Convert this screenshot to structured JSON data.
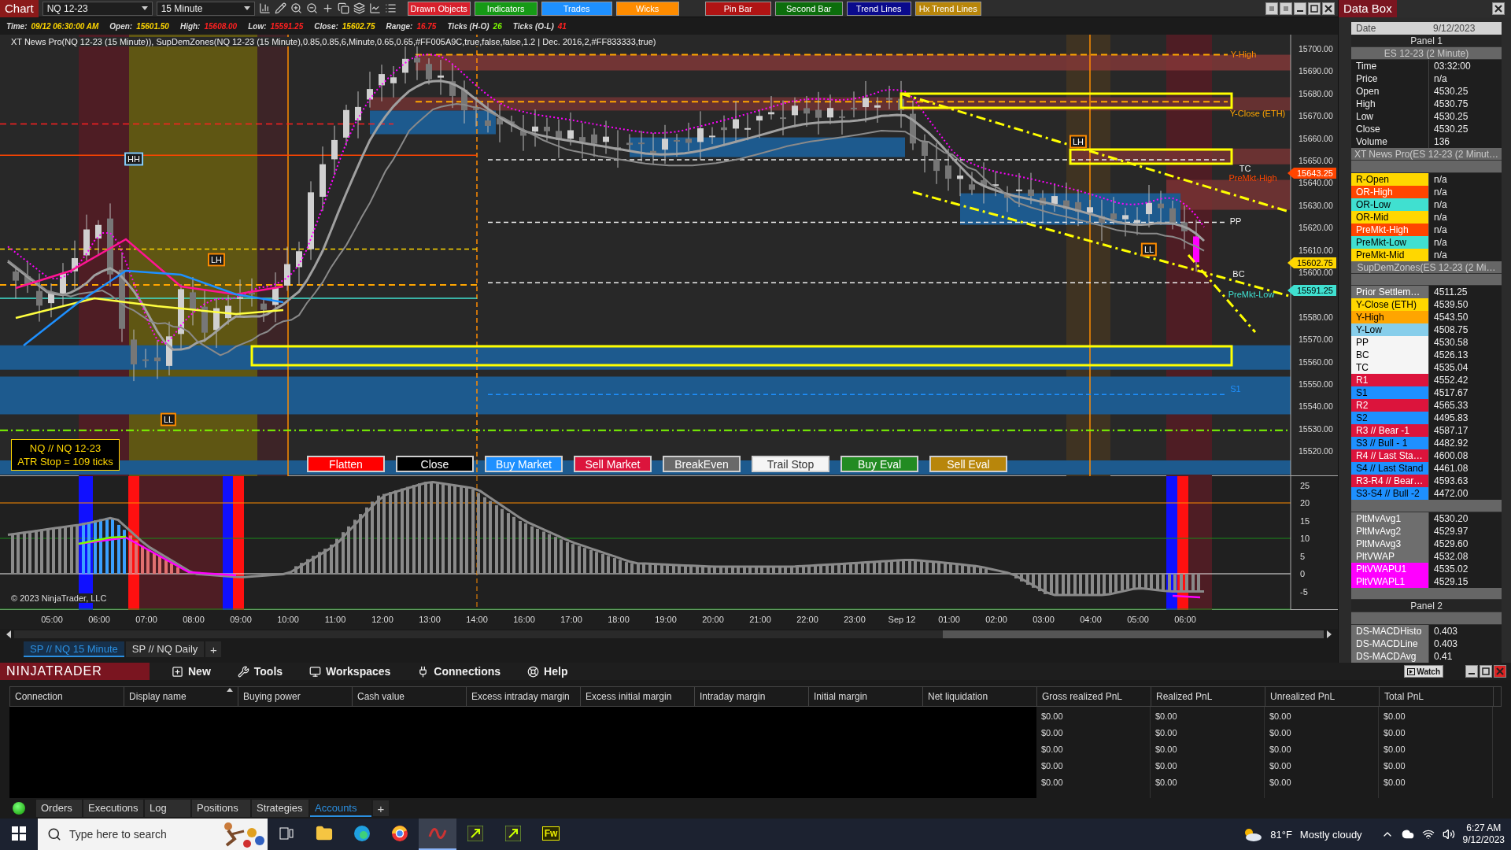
{
  "toolbar": {
    "title": "Chart",
    "instrument": "NQ 12-23",
    "interval": "15 Minute",
    "buttons": [
      {
        "label": "Drawn Objects",
        "color": "#d8202c"
      },
      {
        "label": "Indicators",
        "color": "#169a16"
      },
      {
        "label": "Trades",
        "color": "#1e90ff"
      },
      {
        "label": "Wicks",
        "color": "#ff8c00"
      },
      {
        "label": "Pin Bar",
        "color": "#b01414"
      },
      {
        "label": "Second Bar",
        "color": "#0c6e0c"
      },
      {
        "label": "Trend Lines",
        "color": "#0a0a8c"
      },
      {
        "label": "Hx Trend Lines",
        "color": "#b8860b"
      }
    ]
  },
  "stats": [
    {
      "label": "Time:",
      "value": "09/12 06:30:00 AM",
      "color": "#ffd700"
    },
    {
      "label": "Open:",
      "value": "15601.50",
      "color": "#ffd700"
    },
    {
      "label": "High:",
      "value": "15608.00",
      "color": "#ff2020"
    },
    {
      "label": "Low:",
      "value": "15591.25",
      "color": "#ff2020"
    },
    {
      "label": "Close:",
      "value": "15602.75",
      "color": "#ffd700"
    },
    {
      "label": "Range:",
      "value": "16.75",
      "color": "#ff2020"
    },
    {
      "label": "Ticks (H-O)",
      "value": "26",
      "color": "#7cfc00"
    },
    {
      "label": "Ticks (O-L)",
      "value": "41",
      "color": "#ff2020"
    }
  ],
  "indicator_line": "XT News Pro(NQ 12-23 (15 Minute)), SupDemZones(NQ 12-23 (15 Minute),0.85,0.85,6,Minute,0.65,0.65,#FF005A9C,true,false,false,1.2 | Dec. 2016,2,#FF833333,true)",
  "price_axis": [
    "15700.00",
    "15690.00",
    "15680.00",
    "15670.00",
    "15660.00",
    "15650.00",
    "15640.00",
    "15630.00",
    "15620.00",
    "15610.00",
    "15600.00",
    "15580.00",
    "15570.00",
    "15560.00",
    "15550.00",
    "15540.00",
    "15530.00",
    "15520.00"
  ],
  "price_markers": [
    {
      "text": "15643.25",
      "color": "#ff4500"
    },
    {
      "text": "15602.75",
      "color": "#ffd700"
    },
    {
      "text": "15591.25",
      "color": "#40e0d0"
    }
  ],
  "chart_labels": [
    {
      "text": "HH",
      "kind": "swing",
      "color": "#87cefa"
    },
    {
      "text": "LH",
      "kind": "swing",
      "color": "#ff8c00"
    },
    {
      "text": "LL",
      "kind": "swing",
      "color": "#ff8c00"
    },
    {
      "text": "LH",
      "kind": "swing",
      "color": "#ff8c00"
    },
    {
      "text": "LL",
      "kind": "swing",
      "color": "#ff8c00"
    },
    {
      "text": "Y-High",
      "kind": "level",
      "color": "#ff8c00"
    },
    {
      "text": "Y-Close (ETH)",
      "kind": "level",
      "color": "#ffa500"
    },
    {
      "text": "TC",
      "kind": "level",
      "color": "#f0f0f0"
    },
    {
      "text": "PreMkt-High",
      "kind": "level",
      "color": "#ff4500"
    },
    {
      "text": "PP",
      "kind": "level",
      "color": "#f0f0f0"
    },
    {
      "text": "BC",
      "kind": "level",
      "color": "#f0f0f0"
    },
    {
      "text": "PreMkt-Low",
      "kind": "level",
      "color": "#40e0d0"
    },
    {
      "text": "S1",
      "kind": "level",
      "color": "#1e90ff"
    }
  ],
  "atr_box": [
    "NQ // NQ 12-23",
    "ATR Stop = 109 ticks"
  ],
  "order_buttons": [
    {
      "label": "Flatten",
      "color": "#ff0000"
    },
    {
      "label": "Close",
      "color": "#000000"
    },
    {
      "label": "Buy Market",
      "color": "#1e90ff"
    },
    {
      "label": "Sell Market",
      "color": "#dc143c"
    },
    {
      "label": "BreakEven",
      "color": "#696969"
    },
    {
      "label": "Trail Stop",
      "color": "#f5f5f5"
    },
    {
      "label": "Buy Eval",
      "color": "#228b22"
    },
    {
      "label": "Sell Eval",
      "color": "#b8860b"
    }
  ],
  "macd_axis": [
    "25",
    "20",
    "15",
    "10",
    "5",
    "0",
    "-5"
  ],
  "copyright": "© 2023 NinjaTrader, LLC",
  "time_axis": [
    "05:00",
    "06:00",
    "07:00",
    "08:00",
    "09:00",
    "10:00",
    "11:00",
    "12:00",
    "13:00",
    "14:00",
    "16:00",
    "17:00",
    "18:00",
    "19:00",
    "20:00",
    "21:00",
    "22:00",
    "23:00",
    "Sep 12",
    "01:00",
    "02:00",
    "03:00",
    "04:00",
    "05:00",
    "06:00"
  ],
  "chart_tabs": [
    {
      "label": "SP // NQ  15 Minute",
      "selected": true
    },
    {
      "label": "SP // NQ  Daily",
      "selected": false
    }
  ],
  "add_tab": "+",
  "data_box": {
    "title": "Data Box",
    "rows": [
      {
        "kind": "date",
        "label": "Date",
        "value": "9/12/2023"
      },
      {
        "kind": "panel",
        "text": "Panel 1"
      },
      {
        "kind": "series",
        "text": "ES 12-23 (2 Minute)"
      },
      {
        "kind": "value",
        "label": "Time",
        "value": "03:32:00"
      },
      {
        "kind": "value",
        "label": "Price",
        "value": "n/a"
      },
      {
        "kind": "value",
        "label": "Open",
        "value": "4530.25"
      },
      {
        "kind": "value",
        "label": "High",
        "value": "4530.75"
      },
      {
        "kind": "value",
        "label": "Low",
        "value": "4530.25"
      },
      {
        "kind": "value",
        "label": "Close",
        "value": "4530.25"
      },
      {
        "kind": "value",
        "label": "Volume",
        "value": "136"
      },
      {
        "kind": "series",
        "text": "XT News Pro(ES 12-23 (2 Minut…"
      },
      {
        "kind": "blank"
      },
      {
        "kind": "value",
        "label": "R-Open",
        "value": "n/a",
        "color": "#ffd700"
      },
      {
        "kind": "value",
        "label": "OR-High",
        "value": "n/a",
        "color": "#ff4500"
      },
      {
        "kind": "value",
        "label": "OR-Low",
        "value": "n/a",
        "color": "#40e0d0"
      },
      {
        "kind": "value",
        "label": "OR-Mid",
        "value": "n/a",
        "color": "#ffd700"
      },
      {
        "kind": "value",
        "label": "PreMkt-High",
        "value": "n/a",
        "color": "#ff4500"
      },
      {
        "kind": "value",
        "label": "PreMkt-Low",
        "value": "n/a",
        "color": "#40e0d0"
      },
      {
        "kind": "value",
        "label": "PreMkt-Mid",
        "value": "n/a",
        "color": "#ffd700"
      },
      {
        "kind": "series",
        "text": "SupDemZones(ES 12-23 (2 Mi…"
      },
      {
        "kind": "blank"
      },
      {
        "kind": "value",
        "label": "Prior Settlem…",
        "value": "4511.25",
        "color": "#6e6e6e"
      },
      {
        "kind": "value",
        "label": "Y-Close (ETH)",
        "value": "4539.50",
        "color": "#ffd700"
      },
      {
        "kind": "value",
        "label": "Y-High",
        "value": "4543.50",
        "color": "#ffa500"
      },
      {
        "kind": "value",
        "label": "Y-Low",
        "value": "4508.75",
        "color": "#87ceeb"
      },
      {
        "kind": "value",
        "label": "PP",
        "value": "4530.58",
        "color": "#f5f5f5"
      },
      {
        "kind": "value",
        "label": "BC",
        "value": "4526.13",
        "color": "#f5f5f5"
      },
      {
        "kind": "value",
        "label": "TC",
        "value": "4535.04",
        "color": "#f5f5f5"
      },
      {
        "kind": "value",
        "label": "R1",
        "value": "4552.42",
        "color": "#dc143c"
      },
      {
        "kind": "value",
        "label": "S1",
        "value": "4517.67",
        "color": "#1e90ff"
      },
      {
        "kind": "value",
        "label": "R2",
        "value": "4565.33",
        "color": "#dc143c"
      },
      {
        "kind": "value",
        "label": "S2",
        "value": "4495.83",
        "color": "#1e90ff"
      },
      {
        "kind": "value",
        "label": "R3 // Bear -1",
        "value": "4587.17",
        "color": "#dc143c"
      },
      {
        "kind": "value",
        "label": "S3 // Bull - 1",
        "value": "4482.92",
        "color": "#1e90ff"
      },
      {
        "kind": "value",
        "label": "R4 // Last Sta…",
        "value": "4600.08",
        "color": "#dc143c"
      },
      {
        "kind": "value",
        "label": "S4 // Last Stand",
        "value": "4461.08",
        "color": "#1e90ff"
      },
      {
        "kind": "value",
        "label": "R3-R4 // Bear…",
        "value": "4593.63",
        "color": "#dc143c"
      },
      {
        "kind": "value",
        "label": "S3-S4 // Bull -2",
        "value": "4472.00",
        "color": "#1e90ff"
      },
      {
        "kind": "blank"
      },
      {
        "kind": "value",
        "label": "PltMvAvg1",
        "value": "4530.20",
        "color": "#6e6e6e"
      },
      {
        "kind": "value",
        "label": "PltMvAvg2",
        "value": "4529.97",
        "color": "#6e6e6e"
      },
      {
        "kind": "value",
        "label": "PltMvAvg3",
        "value": "4529.60",
        "color": "#6e6e6e"
      },
      {
        "kind": "value",
        "label": "PltVWAP",
        "value": "4532.08",
        "color": "#6e6e6e"
      },
      {
        "kind": "value",
        "label": "PltVWAPU1",
        "value": "4535.02",
        "color": "#ff00ff"
      },
      {
        "kind": "value",
        "label": "PltVWAPL1",
        "value": "4529.15",
        "color": "#ff00ff"
      },
      {
        "kind": "blank"
      },
      {
        "kind": "panel",
        "text": "Panel 2"
      },
      {
        "kind": "blank"
      },
      {
        "kind": "value",
        "label": "DS-MACDHisto",
        "value": "0.403",
        "color": "#6e6e6e"
      },
      {
        "kind": "value",
        "label": "DS-MACDLine",
        "value": "0.403",
        "color": "#6e6e6e"
      },
      {
        "kind": "value",
        "label": "DS-MACDAvg",
        "value": "0.41",
        "color": "#6e6e6e"
      }
    ]
  },
  "control_center": {
    "logo": "NINJATRADER",
    "menu": [
      "New",
      "Tools",
      "Workspaces",
      "Connections",
      "Help"
    ],
    "watch": "Watch"
  },
  "accounts": {
    "columns": [
      {
        "label": "Connection",
        "sorted": false
      },
      {
        "label": "Display name",
        "sorted": true
      },
      {
        "label": "Buying power",
        "sorted": false
      },
      {
        "label": "Cash value",
        "sorted": false
      },
      {
        "label": "Excess intraday margin",
        "sorted": false
      },
      {
        "label": "Excess initial margin",
        "sorted": false
      },
      {
        "label": "Intraday margin",
        "sorted": false
      },
      {
        "label": "Initial margin",
        "sorted": false
      },
      {
        "label": "Net liquidation",
        "sorted": false
      },
      {
        "label": "Gross realized PnL",
        "sorted": false
      },
      {
        "label": "Realized PnL",
        "sorted": false
      },
      {
        "label": "Unrealized PnL",
        "sorted": false
      },
      {
        "label": "Total PnL",
        "sorted": false
      }
    ],
    "rows": [
      [
        "$0.00",
        "$0.00",
        "$0.00",
        "$0.00"
      ],
      [
        "$0.00",
        "$0.00",
        "$0.00",
        "$0.00"
      ],
      [
        "$0.00",
        "$0.00",
        "$0.00",
        "$0.00"
      ],
      [
        "$0.00",
        "$0.00",
        "$0.00",
        "$0.00"
      ],
      [
        "$0.00",
        "$0.00",
        "$0.00",
        "$0.00"
      ]
    ]
  },
  "bottom_tabs": [
    {
      "label": "Orders",
      "selected": false
    },
    {
      "label": "Executions",
      "selected": false
    },
    {
      "label": "Log",
      "selected": false
    },
    {
      "label": "Positions",
      "selected": false
    },
    {
      "label": "Strategies",
      "selected": false
    },
    {
      "label": "Accounts",
      "selected": true
    }
  ],
  "bottom_add": "+",
  "taskbar": {
    "search_placeholder": "Type here to search",
    "app_label": "Fw",
    "temperature": "81°F",
    "weather": "Mostly cloudy",
    "time": "6:27 AM",
    "date": "9/12/2023"
  }
}
